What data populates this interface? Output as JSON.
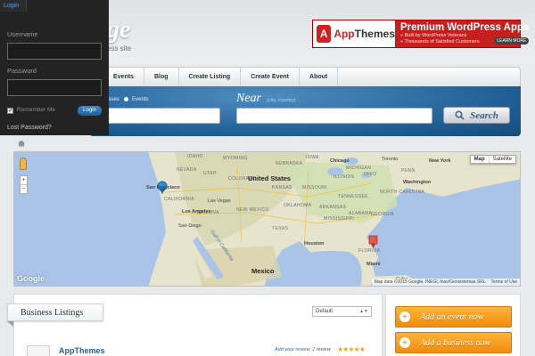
{
  "header": {
    "site_title": "ge",
    "site_tagline": "ess site"
  },
  "ad": {
    "logo_letter": "A",
    "brand_prefix": "App",
    "brand_suffix": "Themes",
    "headline": "Premium WordPress Apps",
    "line1": "» Built by WordPress Veterans",
    "line2": "» Thousands of Satisfied Customers",
    "learn_more": "LEARN MORE"
  },
  "nav": {
    "items": [
      {
        "label": "Events"
      },
      {
        "label": "Blog"
      },
      {
        "label": "Create Listing"
      },
      {
        "label": "Create Event"
      },
      {
        "label": "About"
      }
    ]
  },
  "search": {
    "what_tail": "esses",
    "events_label": "Events",
    "near_label": "Near",
    "near_hint": "(city, country)",
    "button_label": "Search"
  },
  "login": {
    "tab_label": "Login",
    "username_label": "Username",
    "password_label": "Password",
    "remember_label": "Remember Me",
    "button_label": "Login",
    "lost_password": "Lost Password?",
    "remember_checked": true
  },
  "map": {
    "type_map": "Map",
    "type_satellite": "Satellite",
    "zoom_in": "+",
    "zoom_out": "−",
    "google": "Google",
    "attribution": "Map data ©2015 Google, INEGI, Inav/Geosistemas SRL",
    "terms": "Terms of Use",
    "labels": {
      "idaho": "IDAHO",
      "wyoming": "WYOMING",
      "nebraska": "NEBRASKA",
      "iowa": "IOWA",
      "chicago": "Chicago",
      "michigan": "MICHIGAN",
      "toronto": "Toronto",
      "new_york": "New York",
      "nevada": "NEVADA",
      "utah": "UTAH",
      "colorado": "COLORADO",
      "united_states": "United States",
      "kansas": "KANSAS",
      "missouri": "MISSOURI",
      "illinois": "ILLINOIS",
      "ohio": "OHIO",
      "penn": "PENN",
      "washington": "Washington",
      "san_francisco": "San Francisco",
      "california": "CALIFORNIA",
      "las_vegas": "Las Vegas",
      "arizona": "ARIZONA",
      "new_mexico": "NEW MEXICO",
      "oklahoma": "OKLAHOMA",
      "arkansas": "ARKANSAS",
      "tennessee": "TENNESSEE",
      "north_carolina": "NORTH CAROLINA",
      "los_angeles": "Los Angeles",
      "san_diego": "San Diego",
      "texas": "TEXAS",
      "mississippi": "MISSISSIPPI",
      "alabama": "ALABAMA",
      "georgia": "GEORGIA",
      "houston": "Houston",
      "gulf_of_california": "Gulf of California",
      "mexico": "Mexico",
      "florida": "FLORIDA",
      "miami": "Miami",
      "cuba": "Cuba"
    }
  },
  "listings": {
    "tab_label": "Business Listings",
    "sort_value": "Default",
    "item": {
      "title": "AppThemes",
      "review_link": "Add your review",
      "review_count": "1 review",
      "stars": "★★★★★"
    }
  },
  "sidebar": {
    "add_event": "Add an event now",
    "add_business": "Add a business now"
  },
  "colors": {
    "accent_blue": "#1d5d93",
    "cta_orange": "#f08c0c",
    "ad_red": "#c71e1e"
  }
}
